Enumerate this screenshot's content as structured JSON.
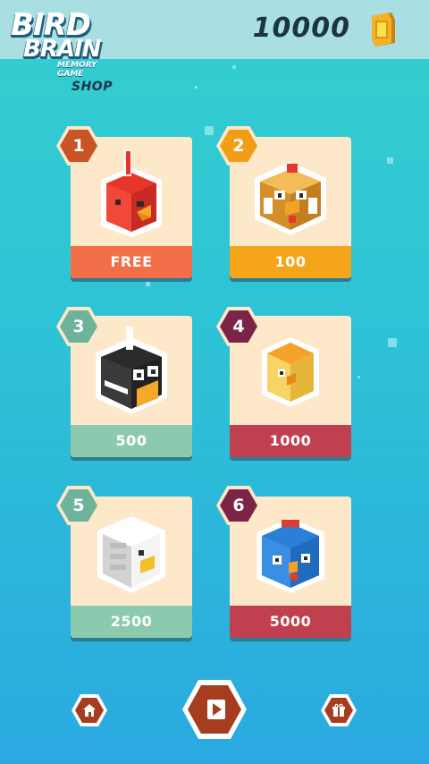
{
  "logo": {
    "line1": "BIRD",
    "line2": "BRAIN",
    "line3": "MEMORY GAME"
  },
  "screen_title": "SHOP",
  "coins": "10000",
  "cards": [
    {
      "number": "1",
      "price": "FREE",
      "bird": "red-bird",
      "hex_color": "#c95527",
      "price_color": "#f36f4a"
    },
    {
      "number": "2",
      "price": "100",
      "bird": "chicken",
      "hex_color": "#f29d16",
      "price_color": "#f5a51a"
    },
    {
      "number": "3",
      "price": "500",
      "bird": "penguin",
      "hex_color": "#6cb39a",
      "price_color": "#8ccaaf"
    },
    {
      "number": "4",
      "price": "1000",
      "bird": "yellow-chick",
      "hex_color": "#7b2447",
      "price_color": "#c1404f"
    },
    {
      "number": "5",
      "price": "2500",
      "bird": "white-bird",
      "hex_color": "#6cb39a",
      "price_color": "#8ccaaf"
    },
    {
      "number": "6",
      "price": "5000",
      "bird": "blue-bird",
      "hex_color": "#7b2447",
      "price_color": "#c1404f"
    }
  ],
  "nav": {
    "home": "home-icon",
    "play": "play-icon",
    "gift": "gift-icon"
  }
}
